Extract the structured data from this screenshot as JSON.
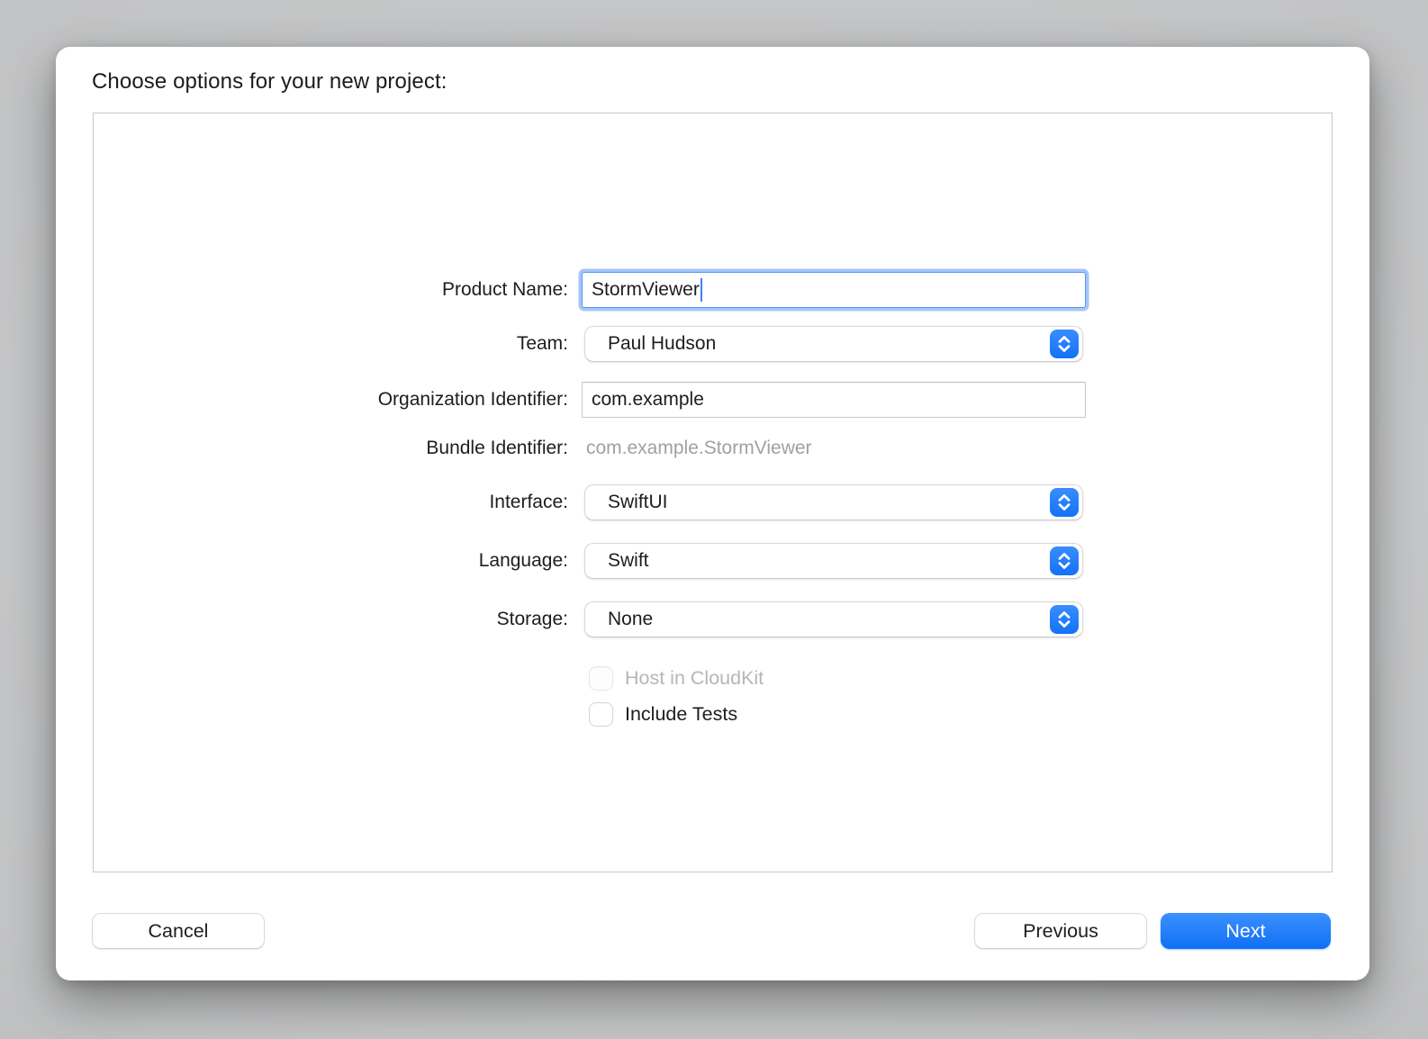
{
  "dialog": {
    "title": "Choose options for your new project:"
  },
  "form": {
    "fields": [
      {
        "id": "product-name",
        "label": "Product Name:",
        "type": "text",
        "value": "StormViewer",
        "state": "focused"
      },
      {
        "id": "team",
        "label": "Team:",
        "type": "dropdown",
        "value": "Paul Hudson"
      },
      {
        "id": "organization-identifier",
        "label": "Organization Identifier:",
        "type": "text",
        "value": "com.example"
      },
      {
        "id": "bundle-identifier",
        "label": "Bundle Identifier:",
        "type": "readonly",
        "value": "com.example.StormViewer"
      },
      {
        "id": "interface",
        "label": "Interface:",
        "type": "dropdown",
        "value": "SwiftUI"
      },
      {
        "id": "language",
        "label": "Language:",
        "type": "dropdown",
        "value": "Swift"
      },
      {
        "id": "storage",
        "label": "Storage:",
        "type": "dropdown",
        "value": "None"
      },
      {
        "id": "host-in-cloudkit",
        "label": "Host in CloudKit",
        "type": "checkbox",
        "checked": false,
        "disabled": true
      },
      {
        "id": "include-tests",
        "label": "Include Tests",
        "type": "checkbox",
        "checked": false,
        "disabled": false
      }
    ]
  },
  "footer": {
    "cancel_label": "Cancel",
    "previous_label": "Previous",
    "next_label": "Next"
  },
  "colors": {
    "accent_blue": "#1d7bf5",
    "next_button_gradient_top": "#3c90fd",
    "next_button_gradient_bottom": "#0f70f5",
    "focus_ring": "#a5c6f8",
    "disabled_text": "#b5b6b8",
    "readonly_text": "#9fa0a2",
    "backdrop_gray": "#c3c4c5"
  }
}
